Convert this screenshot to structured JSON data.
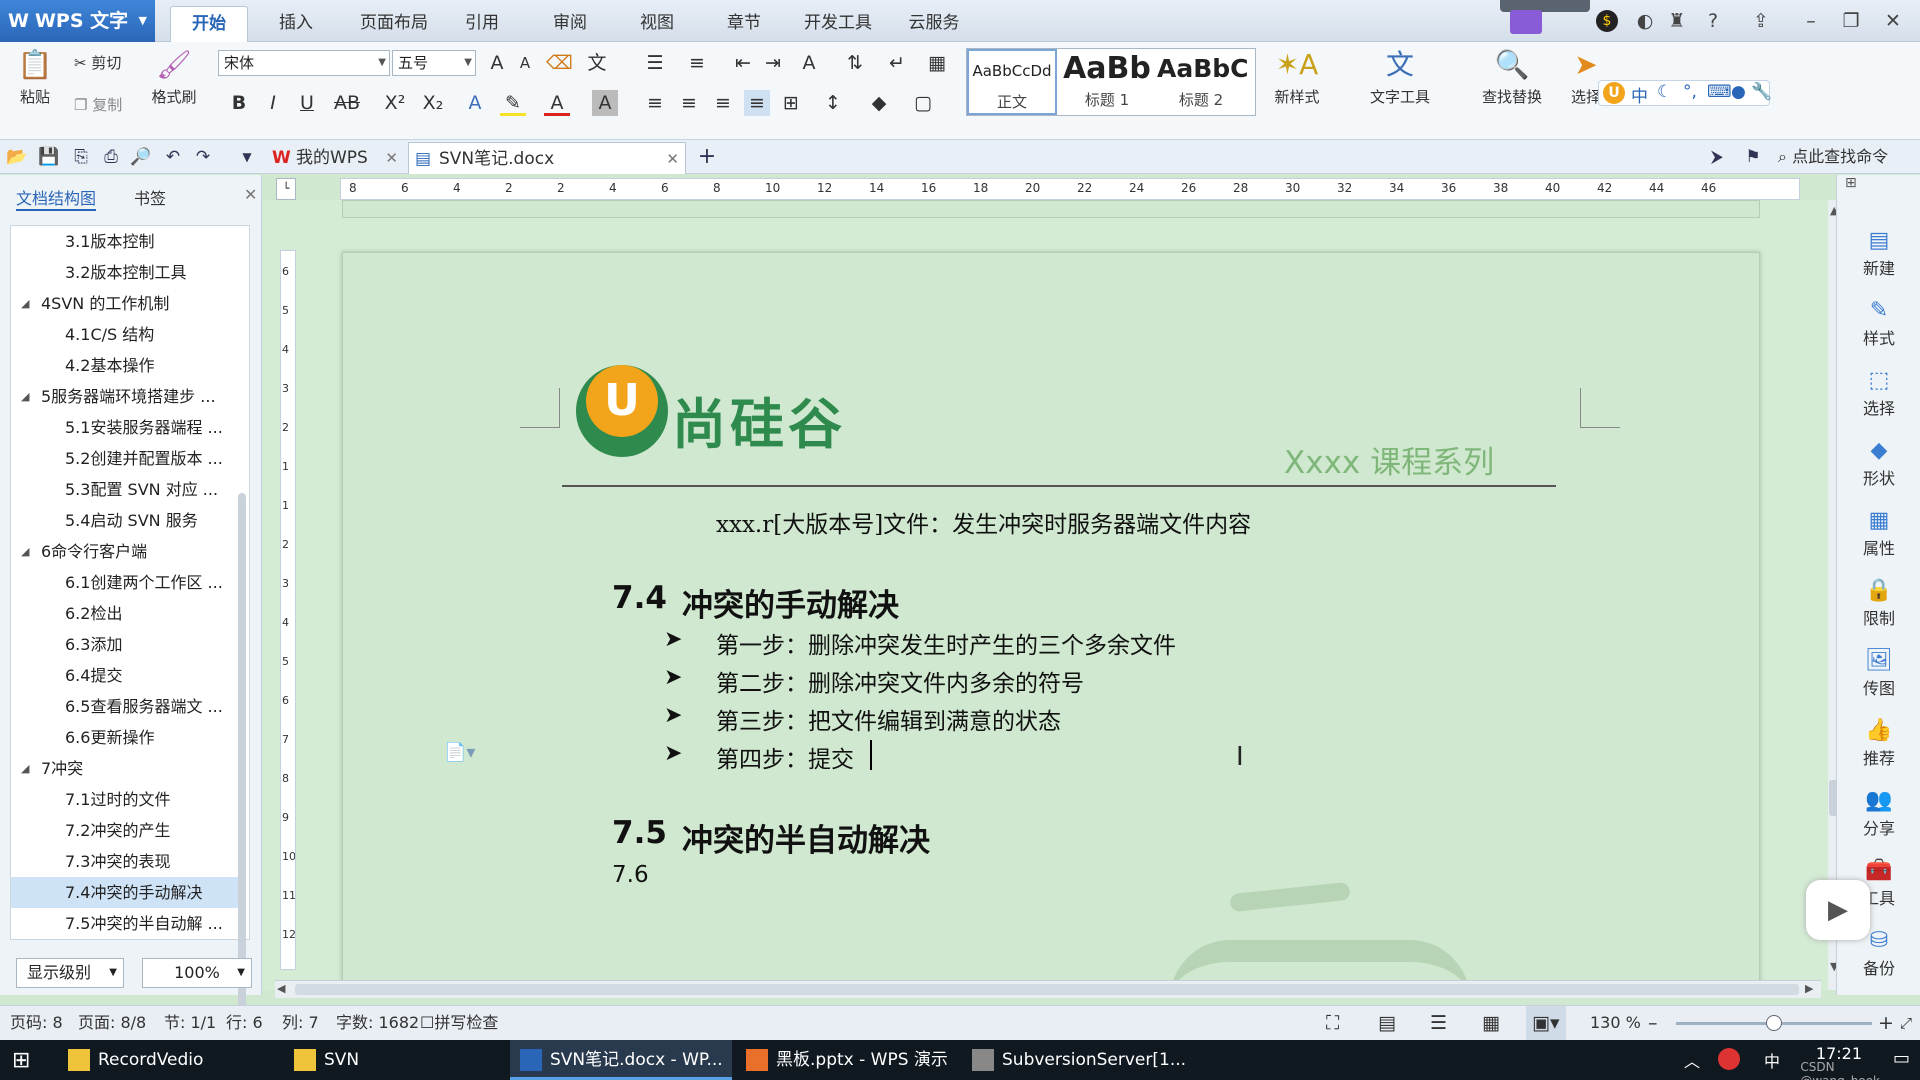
{
  "app": {
    "name": "WPS 文字"
  },
  "menu": [
    "开始",
    "插入",
    "页面布局",
    "引用",
    "审阅",
    "视图",
    "章节",
    "开发工具",
    "云服务"
  ],
  "ribbon": {
    "paste": "粘贴",
    "cut": "剪切",
    "copy": "复制",
    "format_painter": "格式刷",
    "font": "宋体",
    "size": "五号",
    "styles": [
      {
        "preview": "AaBbCcDd",
        "name": "正文"
      },
      {
        "preview": "AaBb",
        "name": "标题 1"
      },
      {
        "preview": "AaBbC",
        "name": "标题 2"
      }
    ],
    "new_style": "新样式",
    "text_tools": "文字工具",
    "find_replace": "查找替换",
    "select": "选择",
    "ime": "中"
  },
  "tabs": [
    {
      "label": "我的WPS"
    },
    {
      "label": "SVN笔记.docx"
    }
  ],
  "search_cmd": "点此查找命令",
  "nav": {
    "tab1": "文档结构图",
    "tab2": "书签",
    "items": [
      {
        "label": "3.1版本控制",
        "level": 2
      },
      {
        "label": "3.2版本控制工具",
        "level": 2
      },
      {
        "label": "4SVN 的工作机制",
        "level": 1
      },
      {
        "label": "4.1C/S 结构",
        "level": 2
      },
      {
        "label": "4.2基本操作",
        "level": 2
      },
      {
        "label": "5服务器端环境搭建步 ...",
        "level": 1
      },
      {
        "label": "5.1安装服务器端程 ...",
        "level": 2
      },
      {
        "label": "5.2创建并配置版本 ...",
        "level": 2
      },
      {
        "label": "5.3配置 SVN 对应 ...",
        "level": 2
      },
      {
        "label": "5.4启动 SVN 服务",
        "level": 2
      },
      {
        "label": "6命令行客户端",
        "level": 1
      },
      {
        "label": "6.1创建两个工作区 ...",
        "level": 2
      },
      {
        "label": "6.2检出",
        "level": 2
      },
      {
        "label": "6.3添加",
        "level": 2
      },
      {
        "label": "6.4提交",
        "level": 2
      },
      {
        "label": "6.5查看服务器端文 ...",
        "level": 2
      },
      {
        "label": "6.6更新操作",
        "level": 2
      },
      {
        "label": "7冲突",
        "level": 1
      },
      {
        "label": "7.1过时的文件",
        "level": 2
      },
      {
        "label": "7.2冲突的产生",
        "level": 2
      },
      {
        "label": "7.3冲突的表现",
        "level": 2
      },
      {
        "label": "7.4冲突的手动解决",
        "level": 2,
        "selected": true
      },
      {
        "label": "7.5冲突的半自动解 ...",
        "level": 2
      }
    ],
    "level_btn": "显示级别",
    "zoom": "100%"
  },
  "ruler_top": [
    "8",
    "6",
    "4",
    "2",
    "2",
    "4",
    "6",
    "8",
    "10",
    "12",
    "14",
    "16",
    "18",
    "20",
    "22",
    "24",
    "26",
    "28",
    "30",
    "32",
    "34",
    "36",
    "38",
    "40",
    "42",
    "44",
    "46"
  ],
  "ruler_left": [
    "6",
    "5",
    "4",
    "3",
    "2",
    "1",
    "1",
    "2",
    "3",
    "4",
    "5",
    "6",
    "7",
    "8",
    "9",
    "10",
    "11",
    "12"
  ],
  "document": {
    "brand": "尚硅谷",
    "series": "Xxxx 课程系列",
    "line1": "xxx.r[大版本号]文件：发生冲突时服务器端文件内容",
    "h74_num": "7.4",
    "h74_title": "冲突的手动解决",
    "steps": [
      "第一步：删除冲突发生时产生的三个多余文件",
      "第二步：删除冲突文件内多余的符号",
      "第三步：把文件编辑到满意的状态",
      "第四步：提交"
    ],
    "h75_num": "7.5",
    "h75_title": "冲突的半自动解决",
    "line_last": "7.6"
  },
  "rightbar": [
    "新建",
    "样式",
    "选择",
    "形状",
    "属性",
    "限制",
    "传图",
    "推荐",
    "分享",
    "工具",
    "备份"
  ],
  "status": {
    "page_code": "页码: 8",
    "page": "页面: 8/8",
    "section": "节: 1/1",
    "row": "行: 6",
    "col": "列: 7",
    "words": "字数: 1682",
    "spell": "拼写检查",
    "zoom": "130 %"
  },
  "taskbar": [
    {
      "label": "RecordVedio"
    },
    {
      "label": "SVN"
    },
    {
      "label": "SVN笔记.docx - WP..."
    },
    {
      "label": "黑板.pptx - WPS 演示"
    },
    {
      "label": "SubversionServer[1..."
    }
  ],
  "tray": {
    "ime": "中",
    "time": "17:21",
    "watermark": "CSDN @wang_book"
  },
  "colors": {
    "doc_bg": "#cfe8cf",
    "brand_green": "#2f8a4d",
    "brand_orange": "#f2a51b",
    "accent": "#2a66b8"
  }
}
